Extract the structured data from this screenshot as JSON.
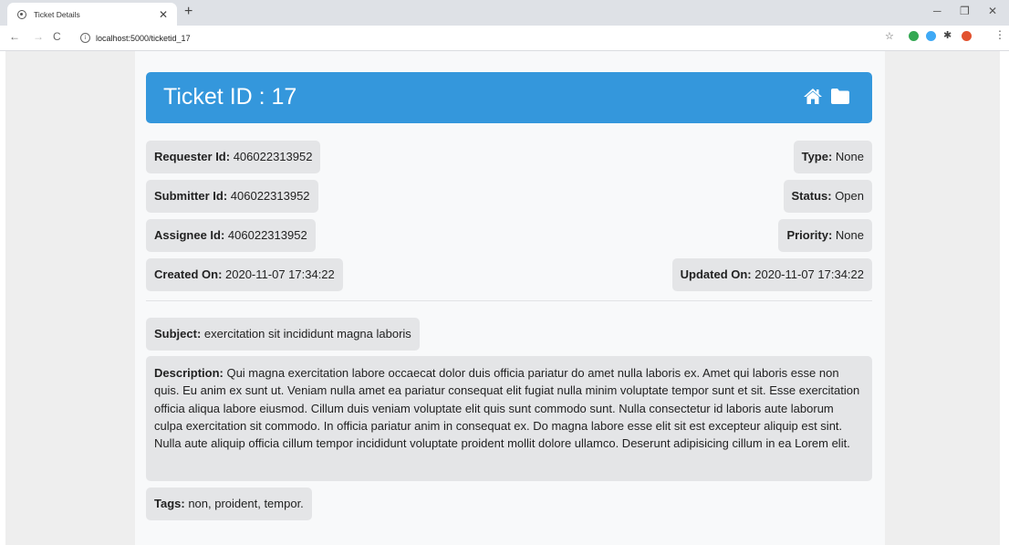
{
  "browser": {
    "tab_title": "Ticket Details",
    "url": "localhost:5000/ticketid_17"
  },
  "header": {
    "title": "Ticket ID : 17",
    "icons": [
      "home-icon",
      "folder-icon"
    ]
  },
  "fields": {
    "requester": {
      "label": "Requester Id:",
      "value": "406022313952"
    },
    "submitter": {
      "label": "Submitter Id:",
      "value": "406022313952"
    },
    "assignee": {
      "label": "Assignee Id:",
      "value": "406022313952"
    },
    "created": {
      "label": "Created On:",
      "value": "2020-11-07 17:34:22"
    },
    "type": {
      "label": "Type:",
      "value": "None"
    },
    "status": {
      "label": "Status:",
      "value": "Open"
    },
    "priority": {
      "label": "Priority:",
      "value": "None"
    },
    "updated": {
      "label": "Updated On:",
      "value": "2020-11-07 17:34:22"
    }
  },
  "subject": {
    "label": "Subject:",
    "value": "exercitation sit incididunt magna laboris"
  },
  "description": {
    "label": "Description:",
    "value": "Qui magna exercitation labore occaecat dolor duis officia pariatur do amet nulla laboris ex. Amet qui laboris esse non quis. Eu anim ex sunt ut. Veniam nulla amet ea pariatur consequat elit fugiat nulla minim voluptate tempor sunt et sit. Esse exercitation officia aliqua labore eiusmod. Cillum duis veniam voluptate elit quis sunt commodo sunt. Nulla consectetur id laboris aute laborum culpa exercitation sit commodo. In officia pariatur anim in consequat ex. Do magna labore esse elit sit est excepteur aliquip est sint. Nulla aute aliquip officia cillum tempor incididunt voluptate proident mollit dolore ullamco. Deserunt adipisicing cillum in ea Lorem elit."
  },
  "tags": {
    "label": "Tags:",
    "value": "non, proident, tempor."
  },
  "colors": {
    "header": "#3497dc",
    "field_bg": "#e4e5e7",
    "page_bg": "#f8f9fa"
  }
}
